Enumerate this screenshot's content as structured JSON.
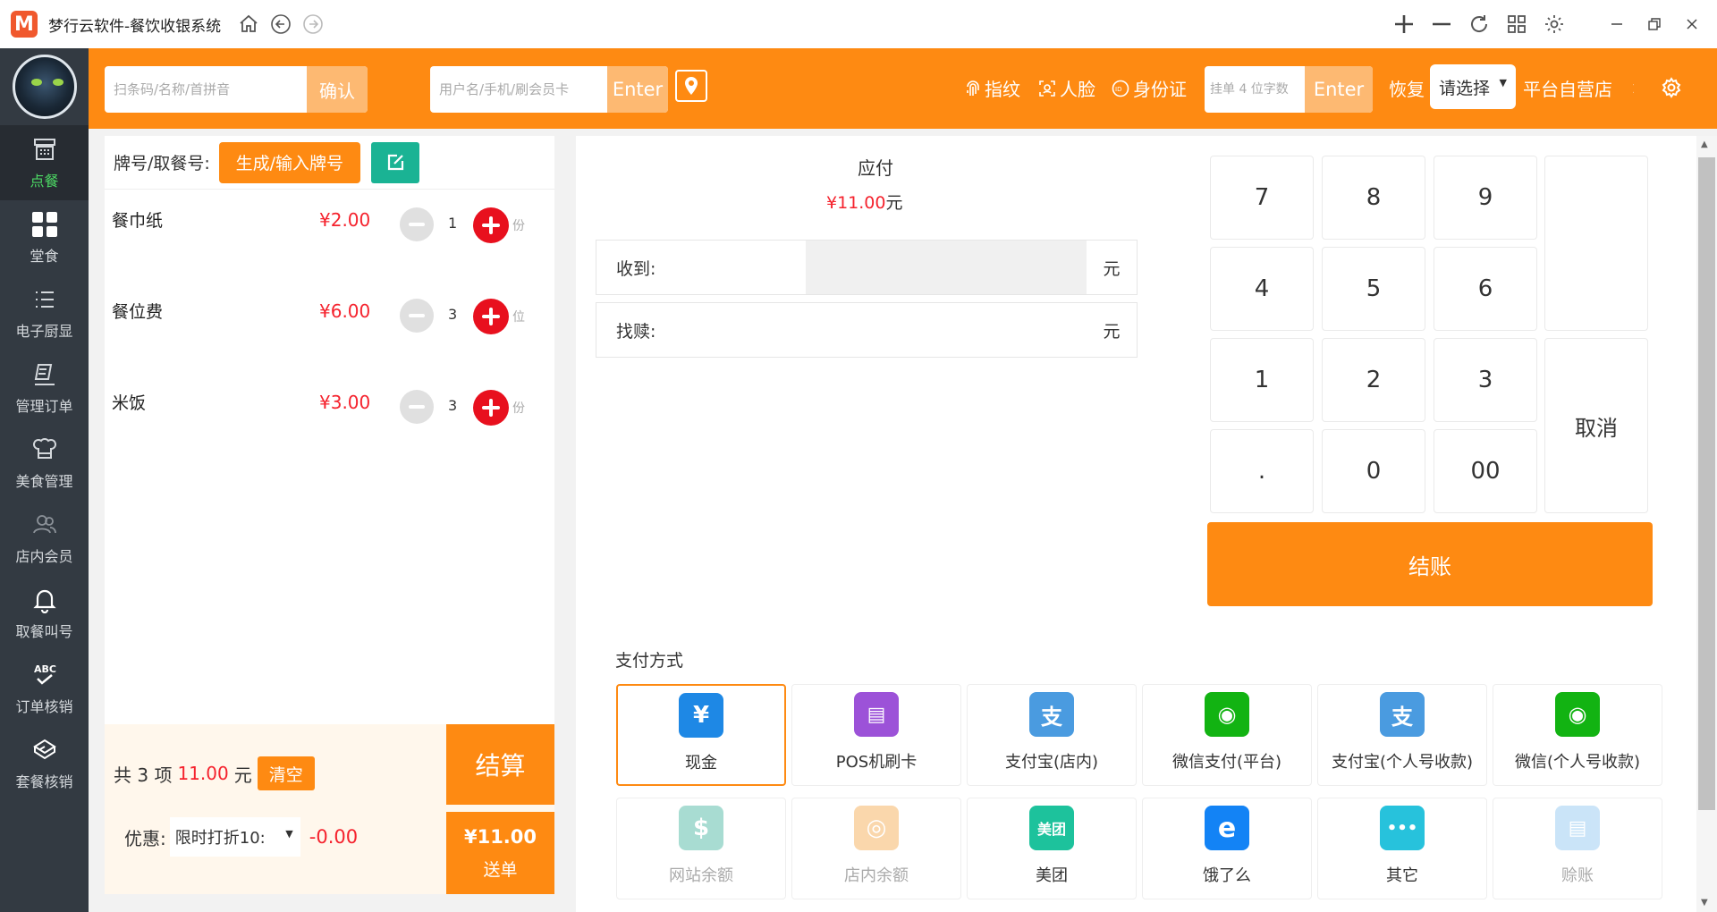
{
  "titlebar": {
    "logo": "M",
    "title": "梦行云软件-餐饮收银系统"
  },
  "sidebar": {
    "items": [
      {
        "label": "点餐",
        "icon": "register-icon"
      },
      {
        "label": "堂食",
        "icon": "grid-icon"
      },
      {
        "label": "电子厨显",
        "icon": "list-icon"
      },
      {
        "label": "管理订单",
        "icon": "order-icon"
      },
      {
        "label": "美食管理",
        "icon": "chef-icon"
      },
      {
        "label": "店内会员",
        "icon": "member-icon"
      },
      {
        "label": "取餐叫号",
        "icon": "bell-icon"
      },
      {
        "label": "订单核销",
        "icon": "abc-check-icon"
      },
      {
        "label": "套餐核销",
        "icon": "package-icon"
      }
    ]
  },
  "topbar": {
    "scan_placeholder": "扫条码/名称/首拼音",
    "scan_btn": "确认",
    "member_placeholder": "用户名/手机/刷会员卡",
    "member_btn": "Enter",
    "fingerprint": "指纹",
    "face": "人脸",
    "idcard": "身份证",
    "hold_placeholder": "挂单 4 位字数",
    "hold_btn": "Enter",
    "restore": "恢复",
    "select_value": "请选择",
    "store": "平台自营店"
  },
  "order": {
    "tag_label": "牌号/取餐号:",
    "gen_btn": "生成/输入牌号",
    "items": [
      {
        "name": "餐巾纸",
        "price": "¥2.00",
        "qty": "1",
        "unit": "份"
      },
      {
        "name": "餐位费",
        "price": "¥6.00",
        "qty": "3",
        "unit": "位"
      },
      {
        "name": "米饭",
        "price": "¥3.00",
        "qty": "3",
        "unit": "份"
      }
    ],
    "summary_prefix": "共 3 项",
    "summary_amount": "11.00",
    "summary_suffix": "元",
    "clear_btn": "清空",
    "discount_label": "优惠:",
    "discount_select": "限时打折10:",
    "discount_amount": "-0.00",
    "settle_btn": "结算",
    "send_price": "¥11.00",
    "send_btn": "送单"
  },
  "payment": {
    "due_label": "应付",
    "due_amount": "¥11.00",
    "due_unit": "元",
    "received_label": "收到:",
    "received_unit": "元",
    "change_label": "找赎:",
    "change_unit": "元",
    "keys": [
      "7",
      "8",
      "9",
      "4",
      "5",
      "6",
      "1",
      "2",
      "3",
      ".",
      "0",
      "00"
    ],
    "cancel_key": "取消",
    "checkout_btn": "结账",
    "methods_title": "支付方式",
    "methods": [
      {
        "label": "现金",
        "icon": "yuan-icon",
        "color": "#1e88e5",
        "glyph": "¥"
      },
      {
        "label": "POS机刷卡",
        "icon": "pos-terminal-icon",
        "color": "#9c52d8",
        "glyph": "▤"
      },
      {
        "label": "支付宝(店内)",
        "icon": "alipay-icon",
        "color": "#4a9be0",
        "glyph": "支"
      },
      {
        "label": "微信支付(平台)",
        "icon": "wechat-icon",
        "color": "#12b312",
        "glyph": "◉"
      },
      {
        "label": "支付宝(个人号收款)",
        "icon": "alipay-icon",
        "color": "#4a9be0",
        "glyph": "支"
      },
      {
        "label": "微信(个人号收款)",
        "icon": "wechat-icon",
        "color": "#12b312",
        "glyph": "◉"
      },
      {
        "label": "网站余额",
        "icon": "money-bag-icon",
        "color": "#3fb39c",
        "glyph": "$"
      },
      {
        "label": "店内余额",
        "icon": "coins-icon",
        "color": "#f6a84a",
        "glyph": "◎"
      },
      {
        "label": "美团",
        "icon": "meituan-icon",
        "color": "#1dc29c",
        "glyph": "美团"
      },
      {
        "label": "饿了么",
        "icon": "eleme-icon",
        "color": "#1383f5",
        "glyph": "e"
      },
      {
        "label": "其它",
        "icon": "more-icon",
        "color": "#27c2dc",
        "glyph": "•••"
      },
      {
        "label": "赊账",
        "icon": "ledger-icon",
        "color": "#8cc4f0",
        "glyph": "▤"
      }
    ]
  }
}
